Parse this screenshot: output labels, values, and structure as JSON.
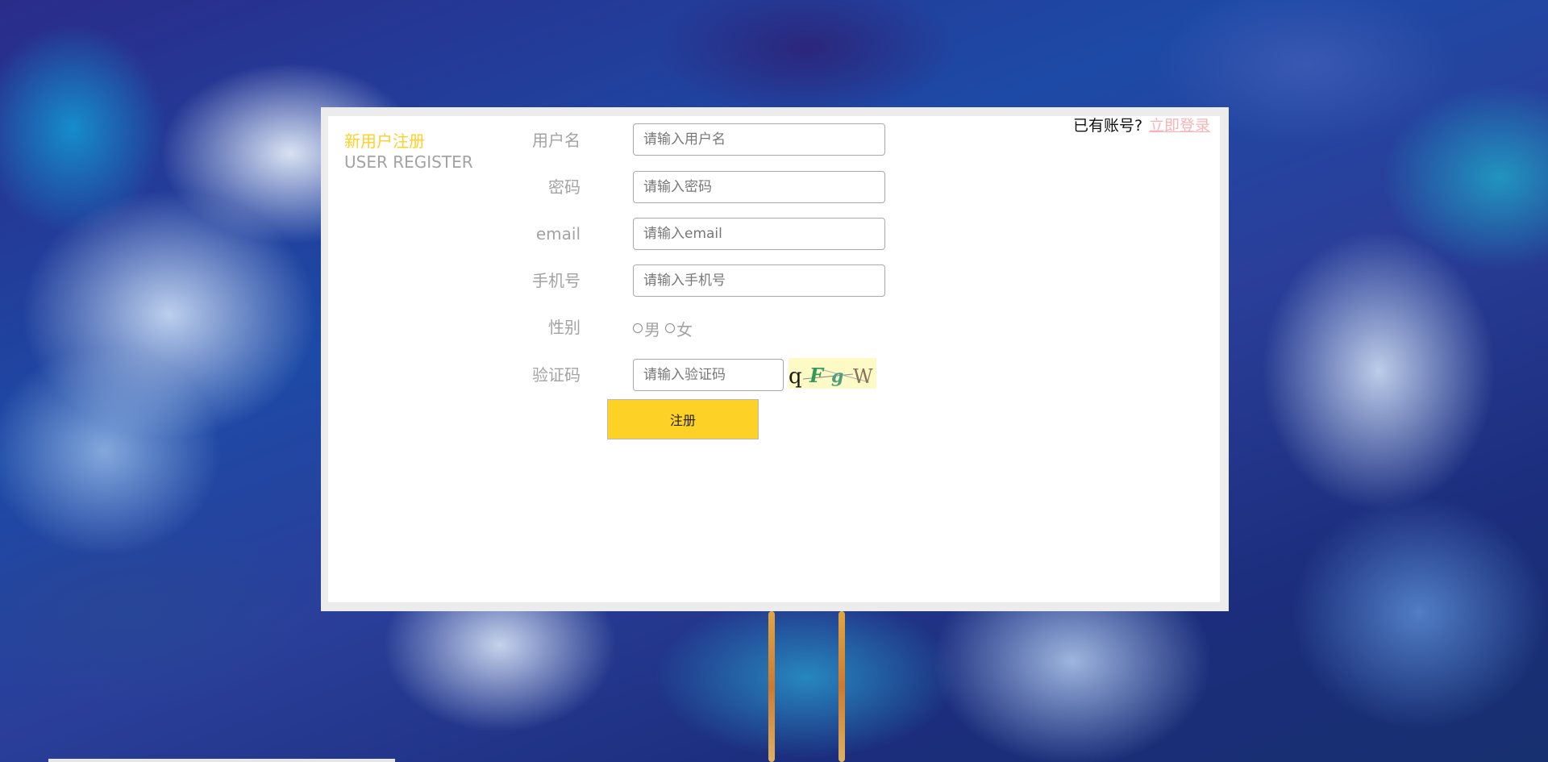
{
  "header": {
    "title_cn": "新用户注册",
    "title_en": "USER REGISTER"
  },
  "login": {
    "prompt": "已有账号?",
    "link": "立即登录"
  },
  "form": {
    "username": {
      "label": "用户名",
      "placeholder": "请输入用户名",
      "value": ""
    },
    "password": {
      "label": "密码",
      "placeholder": "请输入密码",
      "value": ""
    },
    "email": {
      "label": "email",
      "placeholder": "请输入email",
      "value": ""
    },
    "phone": {
      "label": "手机号",
      "placeholder": "请输入手机号",
      "value": ""
    },
    "gender": {
      "label": "性别",
      "options": [
        "男",
        "女"
      ],
      "selected": null
    },
    "captcha": {
      "label": "验证码",
      "placeholder": "请输入验证码",
      "value": "",
      "image_text": "qFgW"
    },
    "submit_label": "注册"
  },
  "colors": {
    "accent": "#ffd026",
    "label_gray": "#a3a3a3",
    "link_pink": "#f7b4b8",
    "button_yellow": "#fdd126",
    "captcha_bg": "#fefac5"
  },
  "icons": {
    "radio": "radio-circle-icon"
  }
}
